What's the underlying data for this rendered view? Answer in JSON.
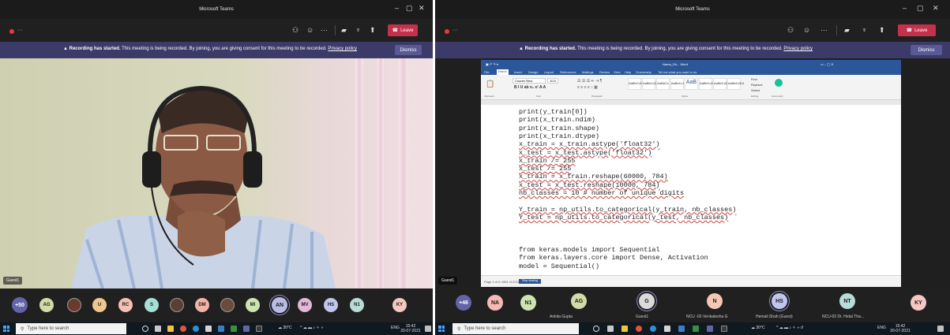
{
  "app_title": "Microsoft Teams",
  "meeting": {
    "recording_banner": {
      "bold": "Recording has started.",
      "text": " This meeting is being recorded. By joining, you are giving consent for this meeting to be recorded. ",
      "link": "Privacy policy",
      "dismiss": "Dismiss"
    },
    "leave_label": "Leave"
  },
  "left_window": {
    "video_label": "Guest1",
    "overflow_count": "+50",
    "participants": [
      {
        "initials": "AG",
        "color": "#d4d9a8"
      },
      {
        "initials": "",
        "color": "#6b3a2f",
        "photo": true
      },
      {
        "initials": "U",
        "color": "#f0c78e"
      },
      {
        "initials": "RC",
        "color": "#f6bfb3"
      },
      {
        "initials": "S",
        "color": "#a5dfd6"
      },
      {
        "initials": "",
        "color": "#5a4034",
        "photo": true
      },
      {
        "initials": "DM",
        "color": "#f3b3a7"
      },
      {
        "initials": "",
        "color": "#6a4b3d",
        "photo": true
      },
      {
        "initials": "MI",
        "color": "#cde3b2"
      },
      {
        "initials": "AN",
        "color": "#b9bde6",
        "ring": true
      },
      {
        "initials": "MV",
        "color": "#e3b7d9"
      },
      {
        "initials": "HS",
        "color": "#c2c6ee"
      },
      {
        "initials": "N1",
        "color": "#b8dcd7"
      },
      {
        "initials": "KY",
        "color": "#f6c7c0"
      }
    ],
    "taskbar": {
      "search_placeholder": "Type here to search",
      "time": "15:42",
      "date": "20-07-2021",
      "lang": "ENG",
      "temp": "30°C"
    }
  },
  "right_window": {
    "video_label": "Guest1",
    "overflow_count": "+46",
    "participants": [
      {
        "initials": "NA",
        "color": "#f6b9b4",
        "name": ""
      },
      {
        "initials": "N1",
        "color": "#cde3b2",
        "name": ""
      },
      {
        "initials": "AG",
        "color": "#d4d9a8",
        "name": "Ankita Gupta"
      },
      {
        "initials": "G",
        "color": "#dadada",
        "name": "Guest1",
        "ring": true
      },
      {
        "initials": "N",
        "color": "#f6c7b2",
        "name": "NCU -02-Venkatesha G"
      },
      {
        "initials": "HS",
        "color": "#c2c6ee",
        "name": "Hemali Shah (Guest)",
        "ring": true
      },
      {
        "initials": "NT",
        "color": "#b8dcd7",
        "name": "NCU-02 Dr. Hetal Tha..."
      },
      {
        "initials": "KY",
        "color": "#f6c7c0",
        "name": ""
      }
    ],
    "word": {
      "doc_title": "Nama_Dh... Word",
      "search_hint": "Tell me what you want to do",
      "tabs": [
        "File",
        "Home",
        "Insert",
        "Design",
        "Layout",
        "References",
        "Mailings",
        "Review",
        "View",
        "Help",
        "Grammarly"
      ],
      "font_name": "Courier New",
      "font_size": "10.5",
      "styles": [
        "AaBbCcDd",
        "AaBbCcDd",
        "AaBbCc",
        "AaBbCcI",
        "AaB",
        "AaBbCcD",
        "AaBbCcDd",
        "AaBbCcDd"
      ],
      "groups": [
        "Clipboard",
        "Font",
        "Paragraph",
        "Styles",
        "Editing",
        "Grammarly"
      ],
      "editing": [
        "Find",
        "Replace",
        "Select"
      ],
      "code": [
        "print(y_train[0])",
        "print(x_train.ndim)",
        "print(x_train.shape)",
        "print(x_train.dtype)",
        "x_train = x_train.astype('float32')",
        "x_test = x_test.astype('float32')",
        "x_train /= 255",
        "x_test /= 255",
        "x_train = x_train.reshape(60000, 784)",
        "x_test = x_test.reshape(10000, 784)",
        "nb_classes = 10 # number of unique digits",
        "",
        "Y_train = np_utils.to_categorical(y_train, nb_classes)",
        "Y_test = np_utils.to_categorical(y_test, nb_classes)",
        "",
        "",
        "",
        "from keras.models import Sequential",
        "from keras.layers.core import Dense, Activation",
        "model = Sequential()"
      ],
      "status": "Page 4 of 6   4354 of 2211 words",
      "status_hl": "Stop sharing"
    },
    "taskbar": {
      "search_placeholder": "Type here to search",
      "time": "15:42",
      "date": "20-07-2021",
      "lang": "ENG",
      "temp": "30°C"
    }
  }
}
